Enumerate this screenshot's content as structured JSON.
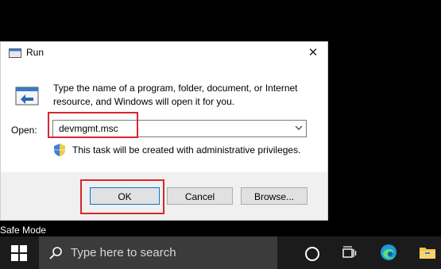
{
  "dialog": {
    "title": "Run",
    "description": "Type the name of a program, folder, document, or Internet resource, and Windows will open it for you.",
    "open_label": "Open:",
    "open_value": "devmgmt.msc",
    "admin_note": "This task will be created with administrative privileges.",
    "buttons": {
      "ok": "OK",
      "cancel": "Cancel",
      "browse": "Browse..."
    }
  },
  "desktop": {
    "safe_mode": "Safe Mode"
  },
  "taskbar": {
    "search_placeholder": "Type here to search"
  },
  "colors": {
    "highlight": "#d7282f",
    "accent": "#0078d7",
    "taskbar": "#1b1b1b",
    "searchbox": "#3b3b3b"
  },
  "icons": [
    "run-icon",
    "close-icon",
    "run-logo-icon",
    "chevron-down-icon",
    "shield-icon",
    "windows-start-icon",
    "search-icon",
    "cortana-icon",
    "task-view-icon",
    "edge-icon",
    "file-explorer-icon"
  ]
}
